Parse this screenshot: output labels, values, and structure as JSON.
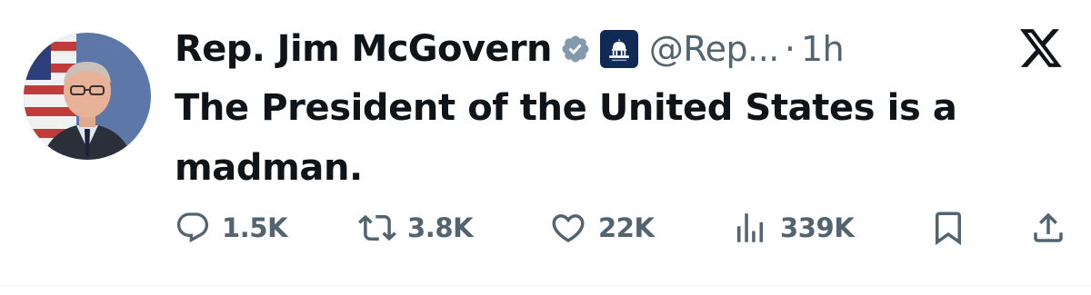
{
  "author": {
    "display_name": "Rep. Jim McGovern",
    "handle": "@Rep...",
    "separator": "·",
    "time": "1h",
    "verified_badge_color": "#829aab",
    "affiliate_badge_color": "#0f2a55"
  },
  "tweet": {
    "text": "The President of the United States is a madman."
  },
  "actions": {
    "replies": "1.5K",
    "reposts": "3.8K",
    "likes": "22K",
    "views": "339K"
  },
  "icons": {
    "platform": "x-logo-icon",
    "reply": "reply-icon",
    "repost": "repost-icon",
    "like": "heart-icon",
    "views": "views-icon",
    "bookmark": "bookmark-icon",
    "share": "share-icon"
  },
  "colors": {
    "text": "#0f1419",
    "secondary": "#536471"
  }
}
